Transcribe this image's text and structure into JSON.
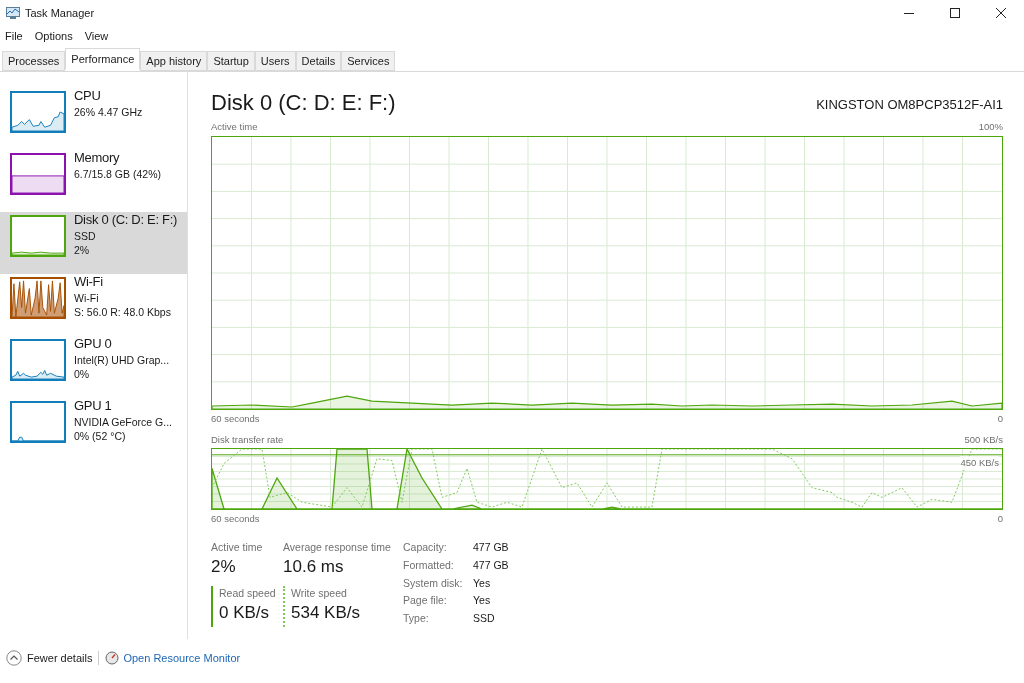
{
  "window": {
    "title": "Task Manager"
  },
  "menu": [
    "File",
    "Options",
    "View"
  ],
  "tabs": [
    {
      "label": "Processes",
      "selected": false
    },
    {
      "label": "Performance",
      "selected": true
    },
    {
      "label": "App history",
      "selected": false
    },
    {
      "label": "Startup",
      "selected": false
    },
    {
      "label": "Users",
      "selected": false
    },
    {
      "label": "Details",
      "selected": false
    },
    {
      "label": "Services",
      "selected": false
    }
  ],
  "sidebar": {
    "items": [
      {
        "name": "CPU",
        "lines": [
          "26% 4.47 GHz"
        ],
        "color": "#117dbb",
        "kind": "cpu",
        "selected": false
      },
      {
        "name": "Memory",
        "lines": [
          "6.7/15.8 GB (42%)"
        ],
        "color": "#8b12ae",
        "kind": "memory",
        "selected": false
      },
      {
        "name": "Disk 0 (C: D: E: F:)",
        "lines": [
          "SSD",
          "2%"
        ],
        "color": "#4da60c",
        "kind": "disk",
        "selected": true
      },
      {
        "name": "Wi-Fi",
        "lines": [
          "Wi-Fi",
          "S: 56.0 R: 48.0 Kbps"
        ],
        "color": "#a74f01",
        "kind": "wifi",
        "selected": false
      },
      {
        "name": "GPU 0",
        "lines": [
          "Intel(R) UHD Grap...",
          "0%"
        ],
        "color": "#117dbb",
        "kind": "gpu",
        "selected": false
      },
      {
        "name": "GPU 1",
        "lines": [
          "NVIDIA GeForce G...",
          "0% (52 °C)"
        ],
        "color": "#117dbb",
        "kind": "idle",
        "selected": false
      }
    ]
  },
  "detail": {
    "title": "Disk 0 (C: D: E: F:)",
    "model": "KINGSTON OM8PCP3512F-AI1",
    "active_chart": {
      "label": "Active time",
      "max": "100%",
      "span": "60 seconds",
      "min": "0"
    },
    "rate_chart": {
      "label": "Disk transfer rate",
      "max": "500 KB/s",
      "marker": "450 KB/s",
      "span": "60 seconds",
      "min": "0"
    },
    "stats": [
      {
        "label": "Active time",
        "value": "2%"
      },
      {
        "label": "Average response time",
        "value": "10.6 ms"
      }
    ],
    "speeds": [
      {
        "label": "Read speed",
        "value": "0 KB/s",
        "kind": "read"
      },
      {
        "label": "Write speed",
        "value": "534 KB/s",
        "kind": "write"
      }
    ],
    "properties": [
      {
        "label": "Capacity:",
        "value": "477 GB"
      },
      {
        "label": "Formatted:",
        "value": "477 GB"
      },
      {
        "label": "System disk:",
        "value": "Yes"
      },
      {
        "label": "Page file:",
        "value": "Yes"
      },
      {
        "label": "Type:",
        "value": "SSD"
      }
    ]
  },
  "footer": {
    "fewer": "Fewer details",
    "monitor": "Open Resource Monitor"
  }
}
